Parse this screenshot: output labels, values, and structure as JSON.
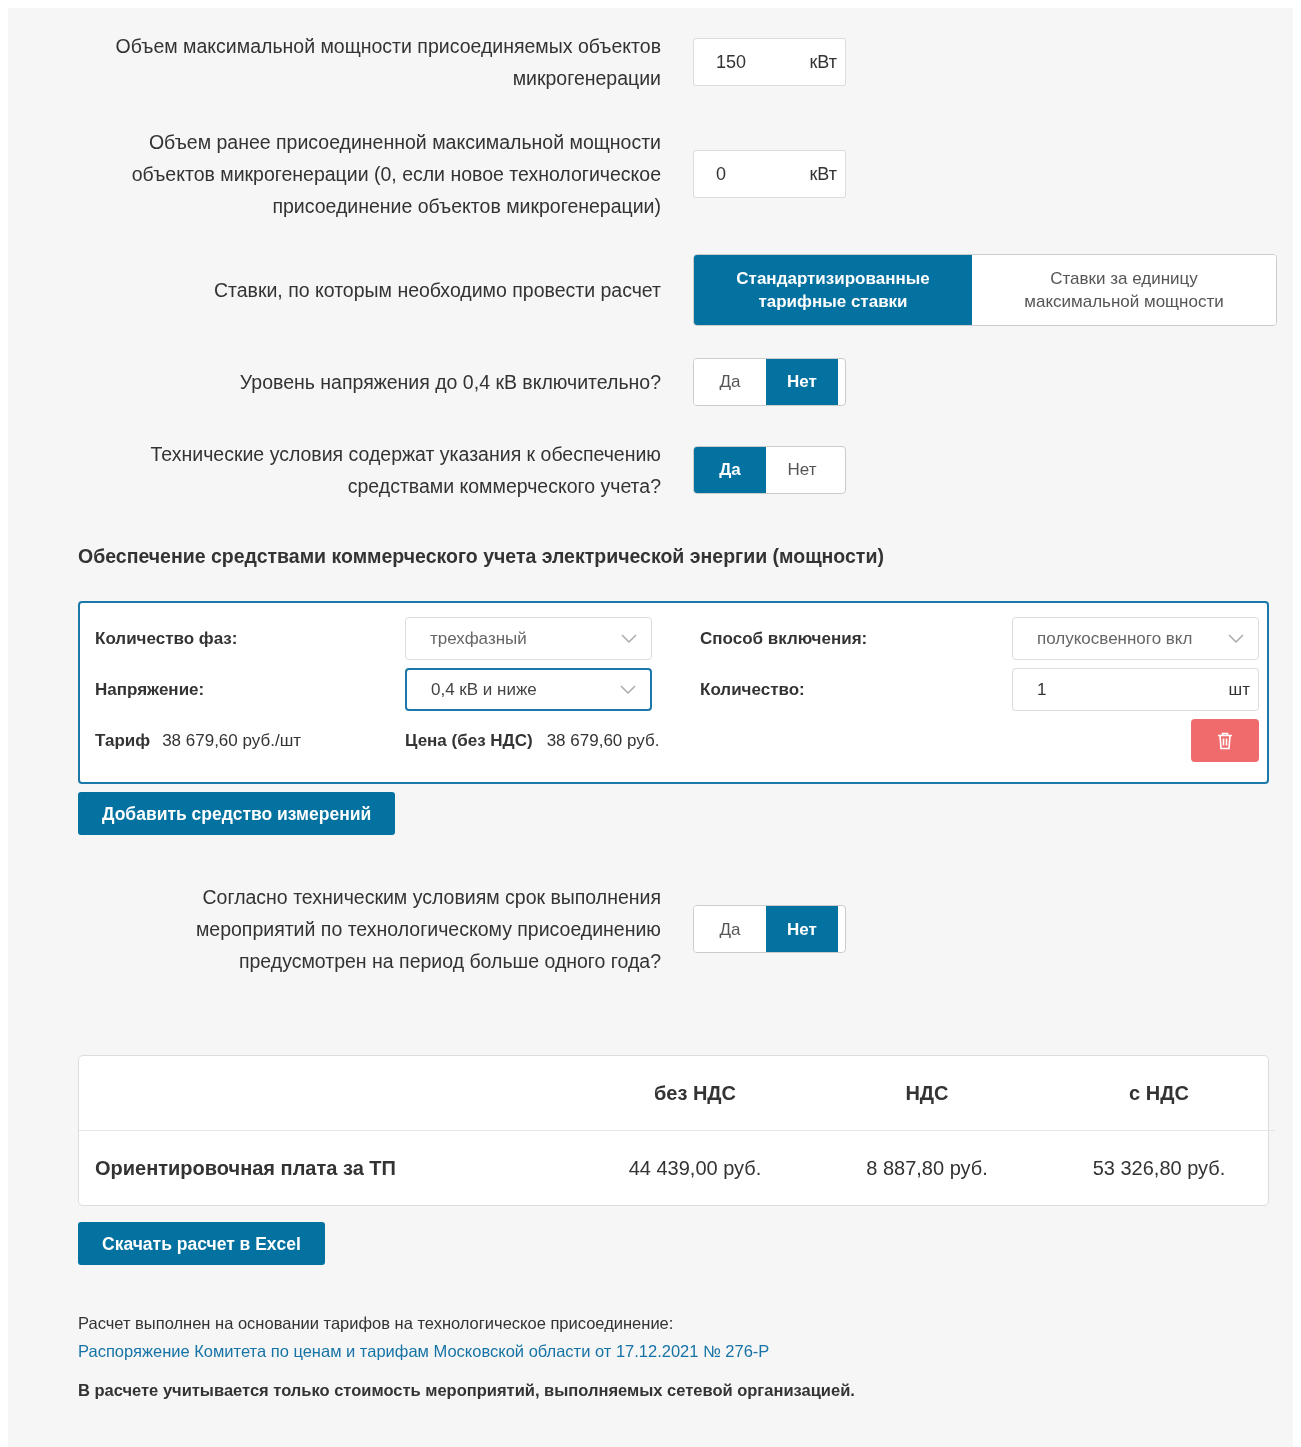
{
  "rows_top": [
    {
      "kind": "input",
      "label": "Объем максимальной мощности присоединяемых объектов микрогенерации",
      "value": "150",
      "unit": "кВт"
    },
    {
      "kind": "input",
      "label": "Объем ранее присоединенной максимальной мощности объектов микрогенерации (0, если новое технологическое присоединение объектов микрогенерации)",
      "value": "0",
      "unit": "кВт"
    },
    {
      "kind": "wide-choice",
      "label": "Ставки, по которым необходимо провести расчет",
      "options": [
        {
          "label": "Стандартизированные тарифные ставки",
          "selected": true
        },
        {
          "label": "Ставки за единицу максимальной мощности",
          "selected": false
        }
      ]
    },
    {
      "kind": "choice",
      "label": "Уровень напряжения до 0,4 кВ включительно?",
      "options": [
        {
          "label": "Да",
          "selected": false
        },
        {
          "label": "Нет",
          "selected": true
        }
      ]
    },
    {
      "kind": "choice",
      "label": "Технические условия содержат указания к обеспечению средствами коммерческого учета?",
      "options": [
        {
          "label": "Да",
          "selected": true
        },
        {
          "label": "Нет",
          "selected": false
        }
      ]
    }
  ],
  "metering": {
    "title": "Обеспечение средствами коммерческого учета электрической энергии (мощности)",
    "phases": {
      "label": "Количество фаз:",
      "value": "трехфазный",
      "focused": false
    },
    "connection": {
      "label": "Способ включения:",
      "value": "полукосвенного вкл",
      "focused": false
    },
    "voltage": {
      "label": "Напряжение:",
      "value": "0,4 кВ и ниже",
      "focused": true
    },
    "quantity": {
      "label": "Количество:",
      "value": "1",
      "unit": "шт"
    },
    "tariff": {
      "label": "Тариф",
      "value": "38 679,60 руб./шт"
    },
    "price": {
      "label": "Цена (без НДС)",
      "value": "38 679,60 руб."
    },
    "add_button": "Добавить средство измерений"
  },
  "rows_bottom": [
    {
      "kind": "choice",
      "label": "Согласно техническим условиям срок выполнения мероприятий по технологическому присоединению предусмотрен на период больше одного года?",
      "options": [
        {
          "label": "Да",
          "selected": false
        },
        {
          "label": "Нет",
          "selected": true
        }
      ]
    }
  ],
  "results": {
    "columns": [
      "без НДС",
      "НДС",
      "с НДС"
    ],
    "rows": [
      {
        "label": "Ориентировочная плата за ТП",
        "cells": [
          "44 439,00 руб.",
          "8 887,80 руб.",
          "53 326,80 руб."
        ]
      }
    ]
  },
  "download_button": "Скачать расчет в Excel",
  "basis_note": "Расчет выполнен на основании тарифов на технологическое присоединение:",
  "basis_link": "Распоряжение Комитета по ценам и тарифам Московской области от 17.12.2021 № 276-Р",
  "disclaimer": "В расчете учитывается только стоимость мероприятий, выполняемых сетевой организацией."
}
